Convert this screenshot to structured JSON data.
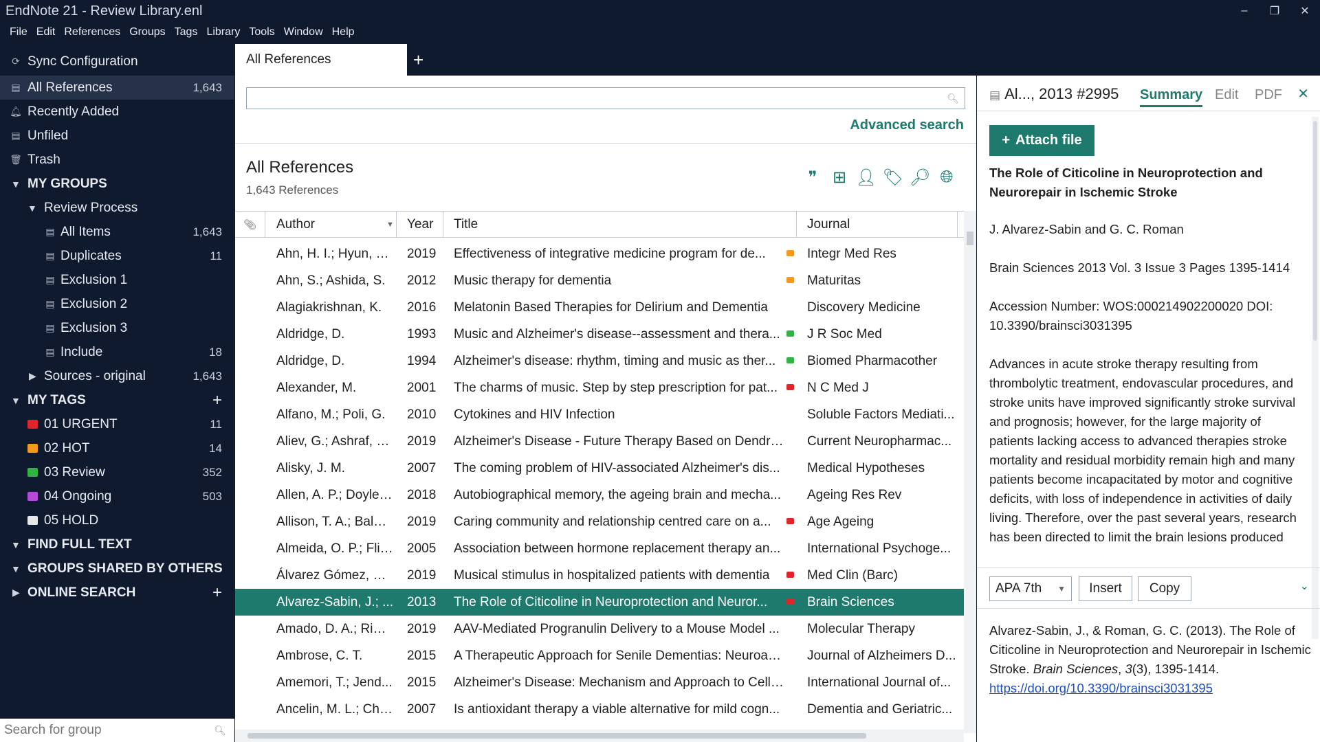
{
  "window": {
    "title": "EndNote 21 - Review Library.enl",
    "controls": [
      "–",
      "❐",
      "✕"
    ]
  },
  "menu": [
    "File",
    "Edit",
    "References",
    "Groups",
    "Tags",
    "Library",
    "Tools",
    "Window",
    "Help"
  ],
  "sidebar": {
    "sync": "Sync Configuration",
    "all_references": {
      "label": "All References",
      "count": "1,643"
    },
    "recently_added": "Recently Added",
    "unfiled": "Unfiled",
    "trash": "Trash",
    "my_groups": "MY GROUPS",
    "review_process": "Review Process",
    "groups": [
      {
        "label": "All Items",
        "count": "1,643"
      },
      {
        "label": "Duplicates",
        "count": "11"
      },
      {
        "label": "Exclusion 1",
        "count": ""
      },
      {
        "label": "Exclusion 2",
        "count": ""
      },
      {
        "label": "Exclusion 3",
        "count": ""
      },
      {
        "label": "Include",
        "count": "18"
      }
    ],
    "sources": {
      "label": "Sources - original",
      "count": "1,643"
    },
    "my_tags": "MY TAGS",
    "tags": [
      {
        "label": "01 URGENT",
        "count": "11",
        "color": "#e0242c"
      },
      {
        "label": "02 HOT",
        "count": "14",
        "color": "#f39a1e"
      },
      {
        "label": "03 Review",
        "count": "352",
        "color": "#2fb344"
      },
      {
        "label": "04 Ongoing",
        "count": "503",
        "color": "#b34ad8"
      },
      {
        "label": "05 HOLD",
        "count": "",
        "color": "#e8e8e8"
      }
    ],
    "find_full_text": "FIND FULL TEXT",
    "groups_shared": "GROUPS SHARED BY OTHERS",
    "online_search": "ONLINE SEARCH",
    "search_placeholder": "Search for group"
  },
  "center": {
    "tab_label": "All References",
    "new_tab": "+",
    "advanced_search": "Advanced search",
    "title": "All References",
    "count": "1,643 References",
    "columns": {
      "author": "Author",
      "year": "Year",
      "title": "Title",
      "journal": "Journal"
    },
    "rows": [
      {
        "author": "Ahn, H. I.; Hyun, M...",
        "year": "2019",
        "title": "Effectiveness of integrative medicine program for de...",
        "flag": "#f39a1e",
        "journal": "Integr Med Res"
      },
      {
        "author": "Ahn, S.; Ashida, S.",
        "year": "2012",
        "title": "Music therapy for dementia",
        "flag": "#f39a1e",
        "journal": "Maturitas"
      },
      {
        "author": "Alagiakrishnan, K.",
        "year": "2016",
        "title": "Melatonin Based Therapies for Delirium and Dementia",
        "flag": "",
        "journal": "Discovery Medicine"
      },
      {
        "author": "Aldridge, D.",
        "year": "1993",
        "title": "Music and Alzheimer's disease--assessment and thera...",
        "flag": "#2fb344",
        "journal": "J R Soc Med"
      },
      {
        "author": "Aldridge, D.",
        "year": "1994",
        "title": "Alzheimer's disease: rhythm, timing and music as ther...",
        "flag": "#2fb344",
        "journal": "Biomed Pharmacother"
      },
      {
        "author": "Alexander, M.",
        "year": "2001",
        "title": "The charms of music. Step by step prescription for pat...",
        "flag": "#e0242c",
        "journal": "N C Med J"
      },
      {
        "author": "Alfano, M.; Poli, G.",
        "year": "2010",
        "title": "Cytokines and HIV Infection",
        "flag": "",
        "journal": "Soluble Factors Mediati..."
      },
      {
        "author": "Aliev, G.; Ashraf, G....",
        "year": "2019",
        "title": "Alzheimer's Disease - Future Therapy Based on Dendri...",
        "flag": "",
        "journal": "Current Neuropharmac..."
      },
      {
        "author": "Alisky, J. M.",
        "year": "2007",
        "title": "The coming problem of HIV-associated Alzheimer's dis...",
        "flag": "",
        "journal": "Medical Hypotheses"
      },
      {
        "author": "Allen, A. P.; Doyle, ...",
        "year": "2018",
        "title": "Autobiographical memory, the ageing brain and mecha...",
        "flag": "",
        "journal": "Ageing Res Rev"
      },
      {
        "author": "Allison, T. A.; Balbi...",
        "year": "2019",
        "title": "Caring community and relationship centred care on a...",
        "flag": "#e0242c",
        "journal": "Age Ageing"
      },
      {
        "author": "Almeida, O. P.; Flic...",
        "year": "2005",
        "title": "Association between hormone replacement therapy an...",
        "flag": "",
        "journal": "International Psychoge..."
      },
      {
        "author": "Álvarez Gómez, E.;...",
        "year": "2019",
        "title": "Musical stimulus in hospitalized patients with dementia",
        "flag": "#e0242c",
        "journal": "Med Clin (Barc)"
      },
      {
        "author": "Alvarez-Sabin, J.; ...",
        "year": "2013",
        "title": "The Role of Citicoline in Neuroprotection and Neuror...",
        "flag": "#e0242c",
        "journal": "Brain Sciences",
        "selected": true
      },
      {
        "author": "Amado, D. A.; Ried...",
        "year": "2019",
        "title": "AAV-Mediated Progranulin Delivery to a Mouse Model ...",
        "flag": "",
        "journal": "Molecular Therapy"
      },
      {
        "author": "Ambrose, C. T.",
        "year": "2015",
        "title": "A Therapeutic Approach for Senile Dementias: Neuroan...",
        "flag": "",
        "journal": "Journal of Alzheimers D..."
      },
      {
        "author": "Amemori, T.; Jend...",
        "year": "2015",
        "title": "Alzheimer's Disease: Mechanism and Approach to Cell T...",
        "flag": "",
        "journal": "International Journal of..."
      },
      {
        "author": "Ancelin, M. L.; Chri...",
        "year": "2007",
        "title": "Is antioxidant therapy a viable alternative for mild cogn...",
        "flag": "",
        "journal": "Dementia and Geriatric..."
      }
    ]
  },
  "detail": {
    "ref_label": "Al..., 2013 #2995",
    "tabs": [
      "Summary",
      "Edit",
      "PDF"
    ],
    "close": "✕",
    "attach": "Attach file",
    "title": "The Role of Citicoline in Neuroprotection and Neurorepair in Ischemic Stroke",
    "authors": "J. Alvarez-Sabin and G. C. Roman",
    "source": "Brain Sciences 2013 Vol. 3 Issue 3 Pages 1395-1414",
    "accession": "Accession Number: WOS:000214902200020 DOI: 10.3390/brainsci3031395",
    "abstract": "Advances in acute stroke therapy resulting from thrombolytic treatment, endovascular procedures, and stroke units have improved significantly stroke survival and prognosis; however, for the large majority of patients lacking access to advanced therapies stroke mortality and residual morbidity remain high and many patients become incapacitated by motor and cognitive deficits, with loss of independence in activities of daily living. Therefore, over the past several years, research has been directed to limit the brain lesions produced",
    "citation_style": "APA 7th",
    "insert": "Insert",
    "copy": "Copy",
    "citation_text": "Alvarez-Sabin, J., & Roman, G. C. (2013). The Role of Citicoline in Neuroprotection and Neurorepair in Ischemic Stroke. ",
    "citation_journal": "Brain Sciences",
    "citation_sep": ", ",
    "citation_volume": "3",
    "citation_rest": "(3), 1395-1414.",
    "citation_link": "https://doi.org/10.3390/brainsci3031395"
  }
}
